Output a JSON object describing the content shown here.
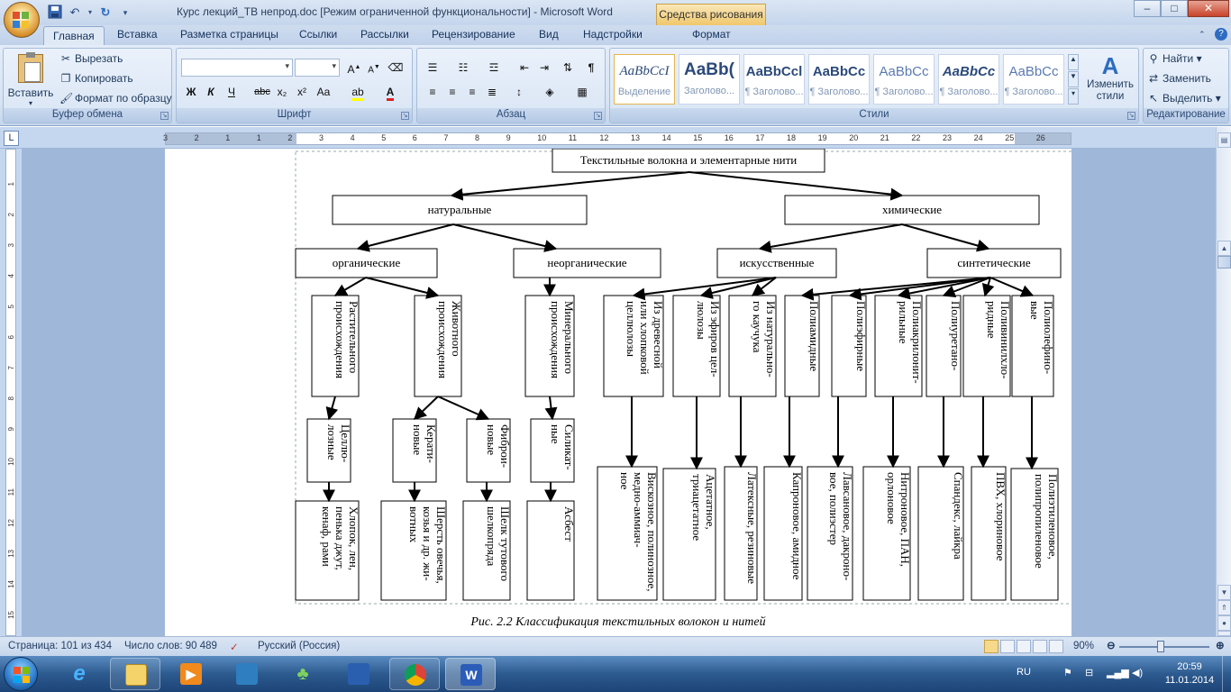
{
  "window": {
    "title": "Курс лекций_ТВ непрод.doc [Режим ограниченной функциональности] - Microsoft Word",
    "contextual_tab_group": "Средства рисования",
    "controls": {
      "minimize": "–",
      "maximize": "□",
      "close": "✕"
    }
  },
  "ribbon": {
    "tabs": [
      "Главная",
      "Вставка",
      "Разметка страницы",
      "Ссылки",
      "Рассылки",
      "Рецензирование",
      "Вид",
      "Надстройки",
      "Формат"
    ],
    "active_tab": "Главная",
    "clipboard": {
      "label": "Буфер обмена",
      "paste": "Вставить",
      "cut": "Вырезать",
      "copy": "Копировать",
      "format_painter": "Формат по образцу"
    },
    "font": {
      "label": "Шрифт",
      "family": "",
      "size": "",
      "buttons": [
        "Ж",
        "К",
        "Ч",
        "abc",
        "x₂",
        "x²",
        "Aa"
      ]
    },
    "paragraph": {
      "label": "Абзац"
    },
    "styles": {
      "label": "Стили",
      "items": [
        {
          "sample": "AaBbCcI",
          "name": "Выделение"
        },
        {
          "sample": "AaBb(",
          "name": "Заголово..."
        },
        {
          "sample": "AaBbCcl",
          "name": "¶ Заголово..."
        },
        {
          "sample": "AaBbCc",
          "name": "¶ Заголово..."
        },
        {
          "sample": "AaBbCc",
          "name": "¶ Заголово..."
        },
        {
          "sample": "AaBbCc",
          "name": "¶ Заголово..."
        },
        {
          "sample": "AaBbCc",
          "name": "¶ Заголово..."
        }
      ],
      "change_styles": "Изменить стили"
    },
    "editing": {
      "label": "Редактирование",
      "find": "Найти",
      "replace": "Заменить",
      "select": "Выделить"
    }
  },
  "ruler": {
    "numbers": [
      "3",
      "2",
      "1",
      "1",
      "2",
      "3",
      "4",
      "5",
      "6",
      "7",
      "8",
      "9",
      "10",
      "11",
      "12",
      "13",
      "14",
      "15",
      "16",
      "17",
      "18",
      "19",
      "20",
      "21",
      "22",
      "23",
      "24",
      "25",
      "26"
    ]
  },
  "vruler": {
    "numbers": [
      "1",
      "2",
      "3",
      "4",
      "5",
      "6",
      "7",
      "8",
      "9",
      "10",
      "11",
      "12",
      "13",
      "14",
      "15"
    ]
  },
  "diagram": {
    "root": "Текстильные волокна и элементарные нити",
    "level1": [
      "натуральные",
      "химические"
    ],
    "level2": [
      "органические",
      "неорганические",
      "искусственные",
      "синтетические"
    ],
    "level3": [
      [
        "Растительного",
        "происхождения"
      ],
      [
        "Животного",
        "происхождения"
      ],
      [
        "Минерального",
        "происхождения"
      ],
      [
        "Из древесной",
        "или хлопковой",
        "целлюлозы"
      ],
      [
        "Из эфиров цел-",
        "люлозы"
      ],
      [
        "Из натурально-",
        "го каучука"
      ],
      [
        "Полиамидные"
      ],
      [
        "Полиэфирные"
      ],
      [
        "Полиакрилонит-",
        "рильные"
      ],
      [
        "Полиуретано-"
      ],
      [
        "Поливинилхло-",
        "ридные"
      ],
      [
        "Полиолефино-",
        "вые"
      ]
    ],
    "level4": [
      [
        "Целлю-",
        "лозные"
      ],
      [
        "Керати-",
        "новые"
      ],
      [
        "Фиброи-",
        "новые"
      ],
      [
        "Силикат-",
        "ные"
      ]
    ],
    "level5": [
      [
        "Хлопок, лен,",
        "пенька джут,",
        "кенаф, рами"
      ],
      [
        "Шерсть овечья,",
        "козья и др. жи-",
        "вотных"
      ],
      [
        "Шелк тутового",
        "шелкопряда"
      ],
      [
        "Асбест"
      ],
      [
        "Вискозное, полинозное,",
        "медно-аммиач-",
        "ное"
      ],
      [
        "Ацетатное,",
        "триацетатное"
      ],
      [
        "Латексные, резиновые"
      ],
      [
        "Капроновое, амидное"
      ],
      [
        "Лавсановое, дакроно-",
        "вое, полиэстер"
      ],
      [
        "Нитроновое, ПАН,",
        "орлоновое"
      ],
      [
        "Спандекс, лайкра"
      ],
      [
        "ПВХ, хлориновое"
      ],
      [
        "Полиэтиленовое,",
        "полипропиленовое"
      ]
    ],
    "caption": "Рис. 2.2 Классификация текстильных волокон и нитей"
  },
  "statusbar": {
    "page": "Страница: 101 из 434",
    "words": "Число слов: 90 489",
    "language": "Русский (Россия)",
    "zoom": "90%",
    "zoom_value": 90
  },
  "taskbar": {
    "language": "RU",
    "time": "20:59",
    "date": "11.01.2014"
  },
  "colors": {
    "ribbon_bg": "#d7e4f3",
    "doc_bg": "#9fb8da",
    "contextual": "#f0c76c",
    "taskbar": "#2c5a8f"
  }
}
